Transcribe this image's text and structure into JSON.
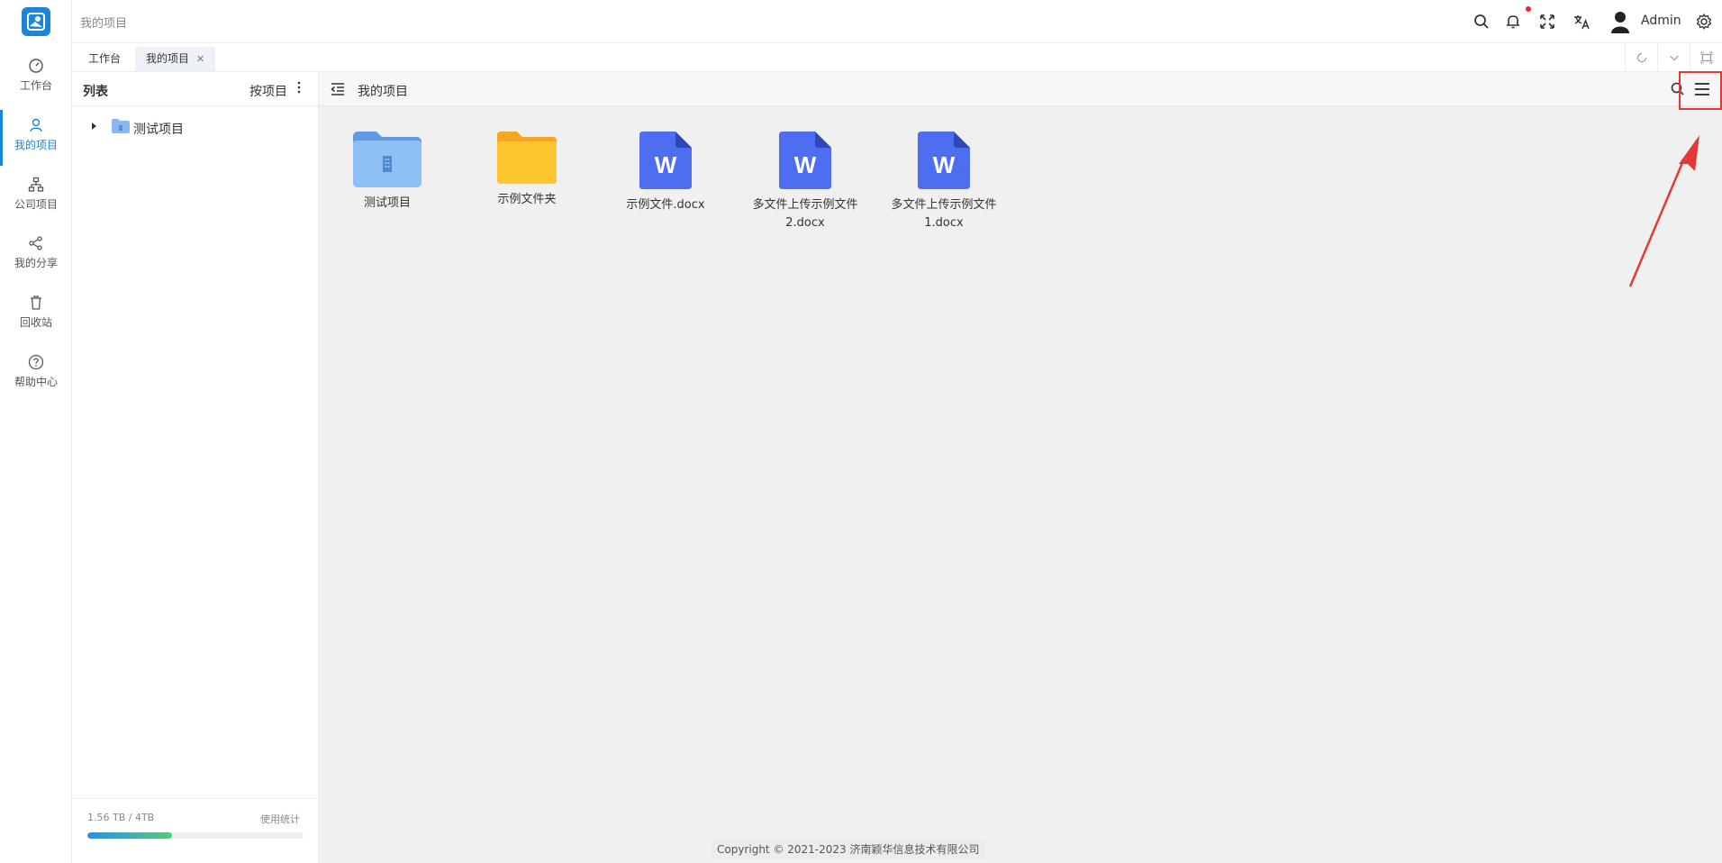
{
  "app": {
    "breadcrumb": "我的项目",
    "user": "Admin"
  },
  "nav": [
    {
      "label": "工作台",
      "icon": "dashboard-icon"
    },
    {
      "label": "我的项目",
      "icon": "user-icon",
      "active": true
    },
    {
      "label": "公司项目",
      "icon": "org-icon"
    },
    {
      "label": "我的分享",
      "icon": "share-icon"
    },
    {
      "label": "回收站",
      "icon": "trash-icon"
    },
    {
      "label": "帮助中心",
      "icon": "help-icon"
    }
  ],
  "tabs": [
    {
      "label": "工作台"
    },
    {
      "label": "我的项目",
      "active": true
    }
  ],
  "list": {
    "title": "列表",
    "sort": "按项目",
    "tree": [
      {
        "label": "测试项目"
      }
    ],
    "usage": {
      "text": "1.56 TB / 4TB",
      "link": "使用统计",
      "fraction": 0.39
    }
  },
  "main": {
    "title": "我的项目",
    "items": [
      {
        "name": "测试项目",
        "type": "project-folder"
      },
      {
        "name": "示例文件夹",
        "type": "folder"
      },
      {
        "name": "示例文件.docx",
        "type": "word"
      },
      {
        "name": "多文件上传示例文件2.docx",
        "type": "word"
      },
      {
        "name": "多文件上传示例文件1.docx",
        "type": "word"
      }
    ]
  },
  "footer": {
    "copyright": "Copyright © 2021-2023 济南颖华信息技术有限公司"
  },
  "colors": {
    "accent": "#1c86d8",
    "word": "#4e6ef2",
    "folder": "#fbc02d",
    "highlight": "#e53935"
  }
}
